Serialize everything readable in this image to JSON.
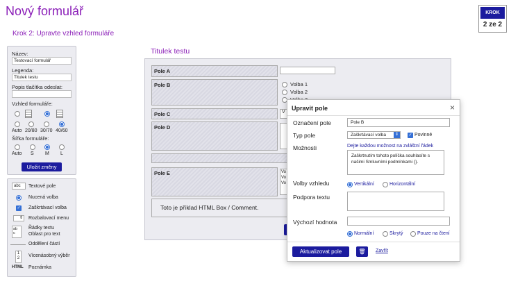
{
  "header": {
    "title": "Nový formulář",
    "subtitle": "Krok 2: Upravte vzhled formuláře",
    "step_label": "KROK",
    "step_value": "2 ze 2"
  },
  "props": {
    "name_label": "Název:",
    "name_value": "Testovací formulář",
    "legend_label": "Legenda:",
    "legend_value": "Titulek testu",
    "submit_label": "Popis tlačítka odeslat:",
    "submit_value": "",
    "layout_label": "Vzhled formuláře:",
    "layout_options": [
      "Auto",
      "20/80",
      "30/70",
      "40/60"
    ],
    "width_label": "Šířka formuláře:",
    "width_options": [
      "Auto",
      "S",
      "M",
      "L"
    ],
    "save_button": "Uložit změny"
  },
  "palette": {
    "items": [
      {
        "icon": "abc",
        "label": "Textové pole"
      },
      {
        "icon": "",
        "label": "Nucená volba"
      },
      {
        "icon": "",
        "label": "Zaškrtávací volba"
      },
      {
        "icon": "",
        "label": "Rozbalovací menu"
      },
      {
        "icon": "ab c",
        "label": "Řádky textu"
      },
      {
        "icon": "",
        "label": "Oblast pro text"
      },
      {
        "icon": "",
        "label": "Oddělení částí"
      },
      {
        "icon": "1 2",
        "label": "Vícenásobný výběr"
      },
      {
        "icon": "HTML",
        "label": "Poznámka"
      }
    ]
  },
  "form": {
    "title": "Titulek testu",
    "fields": [
      "Pole A",
      "Pole B",
      "Pole C",
      "Pole D",
      "Pole E"
    ],
    "pole_b_options": [
      "Volba 1",
      "Volba 2",
      "Volba 3"
    ],
    "pole_c_value": "V",
    "pole_e_lines": [
      "Vo",
      "Vo",
      "Vo"
    ],
    "html_comment": "Toto je příklad HTML Box / Comment."
  },
  "dialog": {
    "title": "Upravit pole",
    "close": "×",
    "label_label": "Označení pole",
    "label_value": "Pole B",
    "type_label": "Typ pole",
    "type_value": "Zaškrtávací volba",
    "required": "Povinné",
    "options_label": "Možnosti",
    "options_hint": "Dejte každou možnost na zvláštní řádek",
    "options_value": "Zaškrtnutím tohoto políčka souhlasíte s našimi Smluvními podmínkami {}.",
    "layout_label": "Volby vzhledu",
    "layout_options": [
      "Vertikální",
      "Horizontální"
    ],
    "help_label": "Podpora textu",
    "default_label": "Výchozí hodnota",
    "visibility_options": [
      "Normální",
      "Skrytý",
      "Pouze na čtení"
    ],
    "update_button": "Aktualizovat pole",
    "close_link": "Zavřít"
  },
  "colors": {
    "accent": "#8b1fb8",
    "primary": "#1b1b9e",
    "radio": "#3570d6"
  }
}
